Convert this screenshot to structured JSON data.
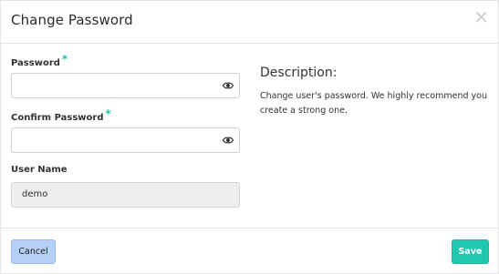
{
  "dialog": {
    "title": "Change Password",
    "close_icon": "close-icon"
  },
  "form": {
    "password": {
      "label": "Password",
      "required_mark": "*",
      "value": "",
      "icon": "eye-icon"
    },
    "confirm_password": {
      "label": "Confirm Password",
      "required_mark": "*",
      "value": "",
      "icon": "eye-icon"
    },
    "user_name": {
      "label": "User Name",
      "value": "demo"
    }
  },
  "description": {
    "heading": "Description:",
    "text": "Change user's password. We highly recommend you create a strong one."
  },
  "footer": {
    "cancel_label": "Cancel",
    "save_label": "Save"
  },
  "colors": {
    "accent": "#20c8b0",
    "cancel_bg": "#b5d0f5",
    "required": "#20c4ac"
  }
}
